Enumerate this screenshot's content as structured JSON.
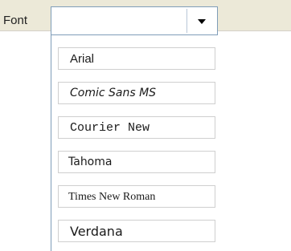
{
  "toolbar": {
    "font_label": "Font",
    "font_combo": {
      "value": "",
      "options": [
        "Arial",
        "Comic Sans MS",
        "Courier New",
        "Tahoma",
        "Times New Roman",
        "Verdana"
      ]
    },
    "dropdown_icon": "chevron-down-icon"
  }
}
